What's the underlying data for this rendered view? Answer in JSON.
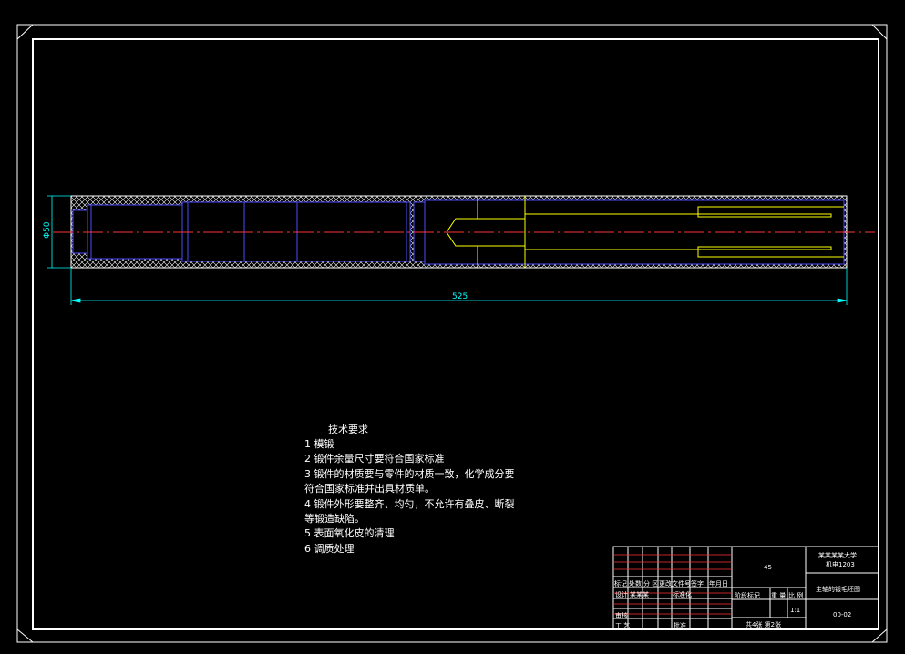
{
  "drawing": {
    "dim_diameter": "Φ50",
    "dim_length": "525"
  },
  "tech_requirements": {
    "title": "技术要求",
    "items": [
      "1 模锻",
      "2 锻件余量尺寸要符合国家标准",
      "3 锻件的材质要与零件的材质一致，化学成分要",
      "符合国家标准并出具材质单。",
      "4 锻件外形要整齐、均匀，不允许有叠皮、断裂",
      "等锻造缺陷。",
      "5 表面氧化皮的清理",
      "6 调质处理"
    ]
  },
  "title_block": {
    "material": "45",
    "school": "某某某某大学",
    "class_name": "机电1203",
    "part_name": "主轴的锻毛坯图",
    "drawing_no": "00-02",
    "scale": "1:1",
    "sheets": "共4张  第2张",
    "labels": {
      "mark": "标记",
      "count": "处数",
      "zone": "分 区",
      "change_doc": "更改文件号",
      "signature": "签字",
      "date": "年月日",
      "design": "设计",
      "designer": "某某某",
      "standardization": "标准化",
      "stage_mark": "阶段标记",
      "weight": "重 量",
      "scale_label": "比 例",
      "review": "审核",
      "process": "工 艺",
      "approve": "批准"
    }
  }
}
